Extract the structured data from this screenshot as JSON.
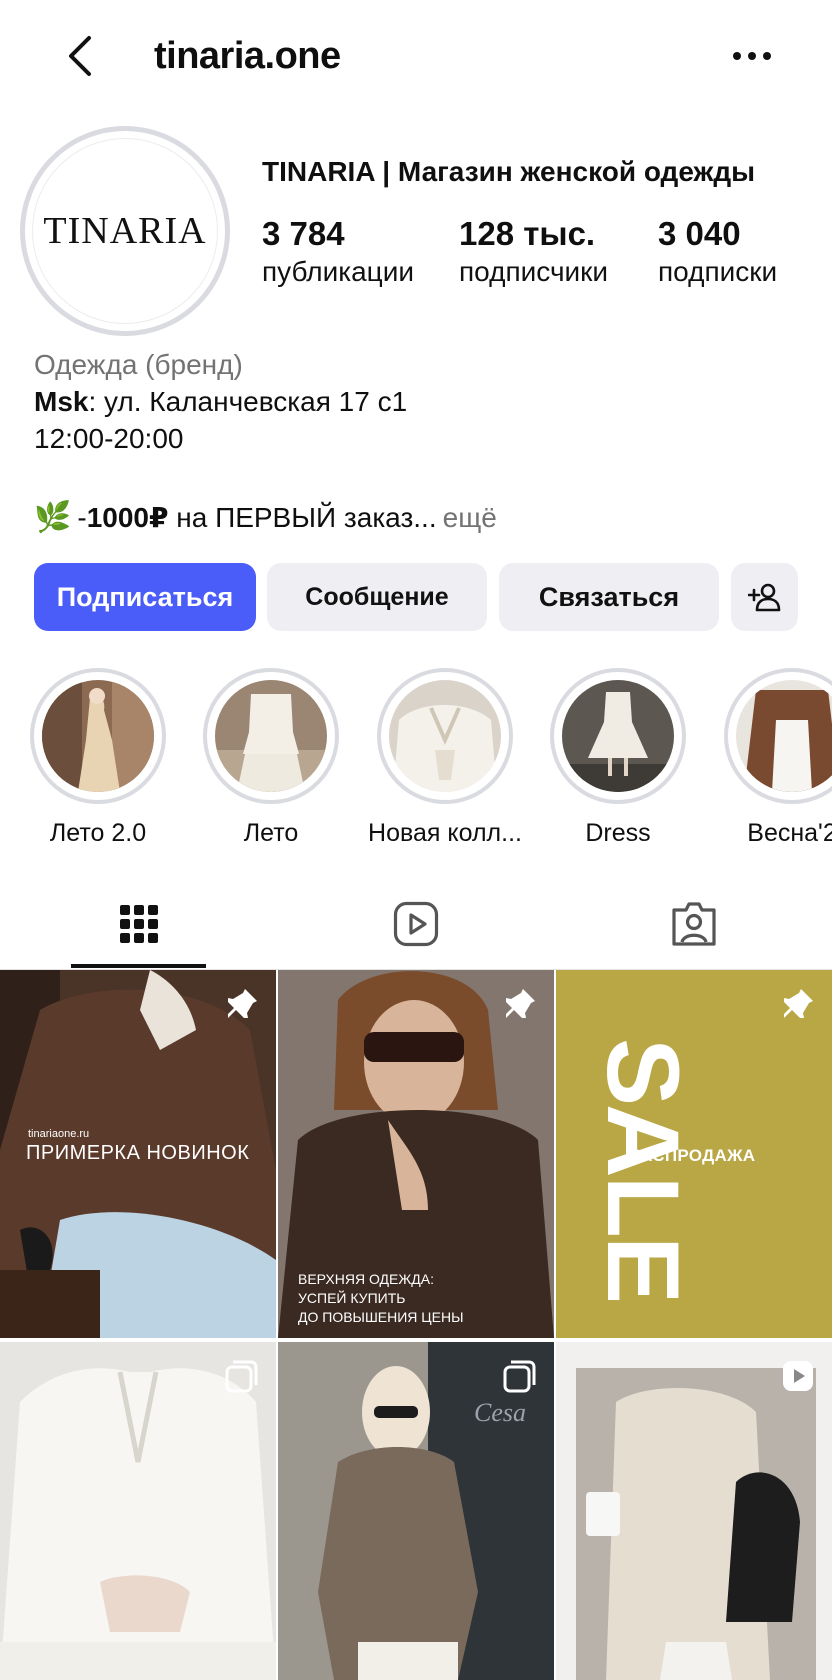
{
  "header": {
    "username": "tinaria.one",
    "back_icon": "back-chevron-icon",
    "more_icon": "more-horizontal-icon"
  },
  "profile": {
    "avatar_text": "TINARIA",
    "full_name": "TINARIA | Магазин женской одежды",
    "stats": [
      {
        "value": "3 784",
        "label": "публикации"
      },
      {
        "value": "128 тыс.",
        "label": "подписчики"
      },
      {
        "value": "3 040",
        "label": "подписки"
      }
    ],
    "category": "Одежда (бренд)",
    "address_bold": "Msk",
    "address_rest": ": ул. Каланчевская 17 с1",
    "hours": "12:00-20:00",
    "promo_prefix": "-",
    "promo_bold": "1000₽",
    "promo_text": " на ПЕРВЫЙ заказ...",
    "promo_more": "ещё"
  },
  "buttons": {
    "follow": "Подписаться",
    "message": "Сообщение",
    "contact": "Связаться",
    "add_icon": "add-person-icon"
  },
  "highlights": [
    {
      "label": "Лето 2.0"
    },
    {
      "label": "Лето"
    },
    {
      "label": "Новая колл..."
    },
    {
      "label": "Dress"
    },
    {
      "label": "Весна'2"
    }
  ],
  "tabs": [
    {
      "icon": "grid-icon",
      "active": true
    },
    {
      "icon": "reels-icon",
      "active": false
    },
    {
      "icon": "tagged-icon",
      "active": false
    }
  ],
  "posts": [
    {
      "badge": "pin-icon",
      "caption_small": "tinariaone.ru",
      "caption": "ПРИМЕРКА НОВИНОК"
    },
    {
      "badge": "pin-icon",
      "caption_lines": [
        "ВЕРХНЯЯ ОДЕЖДА:",
        "УСПЕЙ КУПИТЬ",
        "ДО ПОВЫШЕНИЯ ЦЕНЫ"
      ]
    },
    {
      "badge": "pin-icon",
      "big_text": "SALE",
      "caption": "РАСПРОДАЖА"
    },
    {
      "badge": "carousel-icon"
    },
    {
      "badge": "carousel-icon",
      "sign": "Cesa"
    },
    {
      "badge": "video-icon"
    }
  ],
  "colors": {
    "accent": "#4a5df9",
    "secondary_button": "#efeff3",
    "muted_text": "#737373",
    "sale_tile": "#b8a744"
  }
}
